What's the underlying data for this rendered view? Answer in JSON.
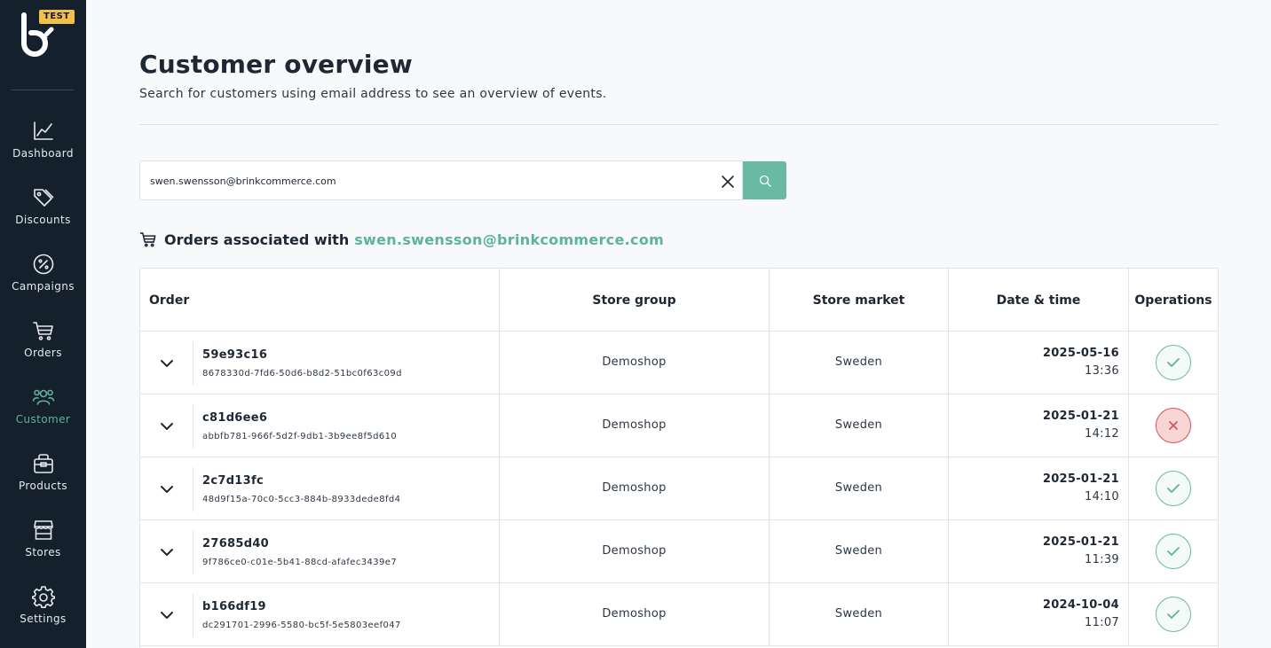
{
  "brand": {
    "badge": "TEST",
    "accent": "#5eb39b",
    "sidebar_bg": "#15202d"
  },
  "nav": [
    {
      "label": "Dashboard",
      "icon": "chart-line-icon",
      "active": false
    },
    {
      "label": "Discounts",
      "icon": "tags-icon",
      "active": false
    },
    {
      "label": "Campaigns",
      "icon": "percent-badge-icon",
      "active": false
    },
    {
      "label": "Orders",
      "icon": "cart-icon",
      "active": false
    },
    {
      "label": "Customer",
      "icon": "users-icon",
      "active": true
    },
    {
      "label": "Products",
      "icon": "basket-icon",
      "active": false
    },
    {
      "label": "Stores",
      "icon": "storefront-icon",
      "active": false
    },
    {
      "label": "Settings",
      "icon": "gear-icon",
      "active": false
    }
  ],
  "page": {
    "title": "Customer overview",
    "subtitle": "Search for customers using email address to see an overview of events."
  },
  "search": {
    "value": "swen.swensson@brinkcommerce.com",
    "placeholder": ""
  },
  "orders": {
    "heading_prefix": "Orders associated with",
    "email": "swen.swensson@brinkcommerce.com",
    "columns": [
      "Order",
      "Store group",
      "Store market",
      "Date & time",
      "Operations"
    ],
    "rows": [
      {
        "id": "59e93c16",
        "ref": "8678330d-7fd6-50d6-b8d2-51bc0f63c09d",
        "store_group": "Demoshop",
        "store_market": "Sweden",
        "date": "2025-05-16",
        "time": "13:36",
        "status": "ok"
      },
      {
        "id": "c81d6ee6",
        "ref": "abbfb781-966f-5d2f-9db1-3b9ee8f5d610",
        "store_group": "Demoshop",
        "store_market": "Sweden",
        "date": "2025-01-21",
        "time": "14:12",
        "status": "fail"
      },
      {
        "id": "2c7d13fc",
        "ref": "48d9f15a-70c0-5cc3-884b-8933dede8fd4",
        "store_group": "Demoshop",
        "store_market": "Sweden",
        "date": "2025-01-21",
        "time": "14:10",
        "status": "ok"
      },
      {
        "id": "27685d40",
        "ref": "9f786ce0-c01e-5b41-88cd-afafec3439e7",
        "store_group": "Demoshop",
        "store_market": "Sweden",
        "date": "2025-01-21",
        "time": "11:39",
        "status": "ok"
      },
      {
        "id": "b166df19",
        "ref": "dc291701-2996-5580-bc5f-5e5803eef047",
        "store_group": "Demoshop",
        "store_market": "Sweden",
        "date": "2024-10-04",
        "time": "11:07",
        "status": "ok"
      }
    ]
  }
}
